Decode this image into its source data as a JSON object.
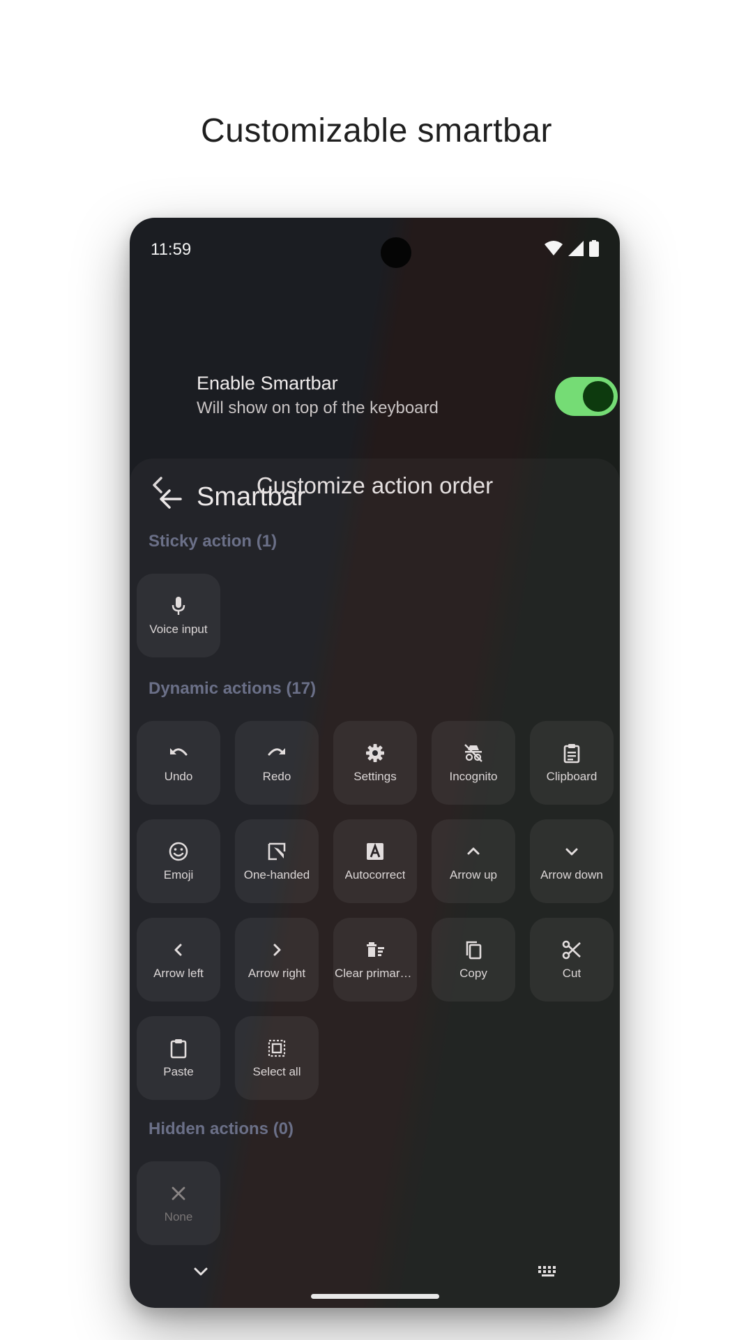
{
  "caption": "Customizable smartbar",
  "status": {
    "time": "11:59"
  },
  "appbar": {
    "title": "Smartbar"
  },
  "setting": {
    "title": "Enable Smartbar",
    "subtitle": "Will show on top of the keyboard",
    "enabled": true
  },
  "sheet": {
    "title": "Customize action order",
    "sticky": {
      "label": "Sticky action (1)",
      "items": [
        {
          "label": "Voice input",
          "icon": "mic-icon"
        }
      ]
    },
    "dynamic": {
      "label": "Dynamic actions (17)",
      "items": [
        {
          "label": "Undo",
          "icon": "undo-icon"
        },
        {
          "label": "Redo",
          "icon": "redo-icon"
        },
        {
          "label": "Settings",
          "icon": "gear-icon"
        },
        {
          "label": "Incognito",
          "icon": "incognito-icon"
        },
        {
          "label": "Clipboard",
          "icon": "clipboard-icon"
        },
        {
          "label": "Emoji",
          "icon": "emoji-icon"
        },
        {
          "label": "One-handed",
          "icon": "one-handed-icon"
        },
        {
          "label": "Autocorrect",
          "icon": "autocorrect-icon"
        },
        {
          "label": "Arrow up",
          "icon": "chevron-up-icon"
        },
        {
          "label": "Arrow down",
          "icon": "chevron-down-icon"
        },
        {
          "label": "Arrow left",
          "icon": "chevron-left-icon"
        },
        {
          "label": "Arrow right",
          "icon": "chevron-right-icon"
        },
        {
          "label": "Clear primary…",
          "icon": "clear-clip-icon"
        },
        {
          "label": "Copy",
          "icon": "copy-icon"
        },
        {
          "label": "Cut",
          "icon": "scissors-icon"
        },
        {
          "label": "Paste",
          "icon": "paste-icon"
        },
        {
          "label": "Select all",
          "icon": "select-all-icon"
        }
      ]
    },
    "hidden": {
      "label": "Hidden actions (0)",
      "items": [
        {
          "label": "None",
          "icon": "close-icon"
        }
      ]
    }
  },
  "colors": {
    "accent": "#75dc75",
    "knob": "#0d3a0e",
    "section_label": "#6b7088"
  }
}
